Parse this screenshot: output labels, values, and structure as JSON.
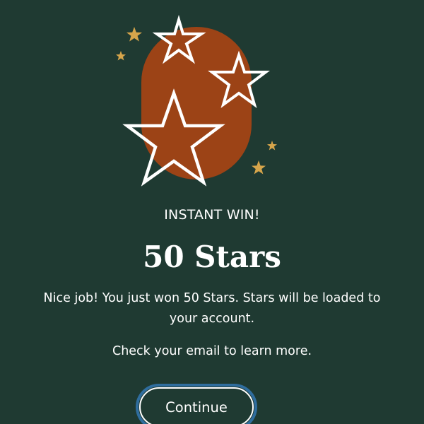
{
  "illustration": {
    "icon": "stars-award-icon",
    "background_color": "#1f3a32",
    "pill_color": "#9c4316",
    "star_outline_color": "#ffffff",
    "sparkle_color": "#d6a54b"
  },
  "content": {
    "eyebrow": "INSTANT WIN!",
    "headline": "50 Stars",
    "message": "Nice job! You just won 50 Stars. Stars will be loaded to your account.",
    "secondary_message": "Check your email to learn more."
  },
  "actions": {
    "continue_label": "Continue",
    "focus_ring_color": "#2f6d9e"
  }
}
